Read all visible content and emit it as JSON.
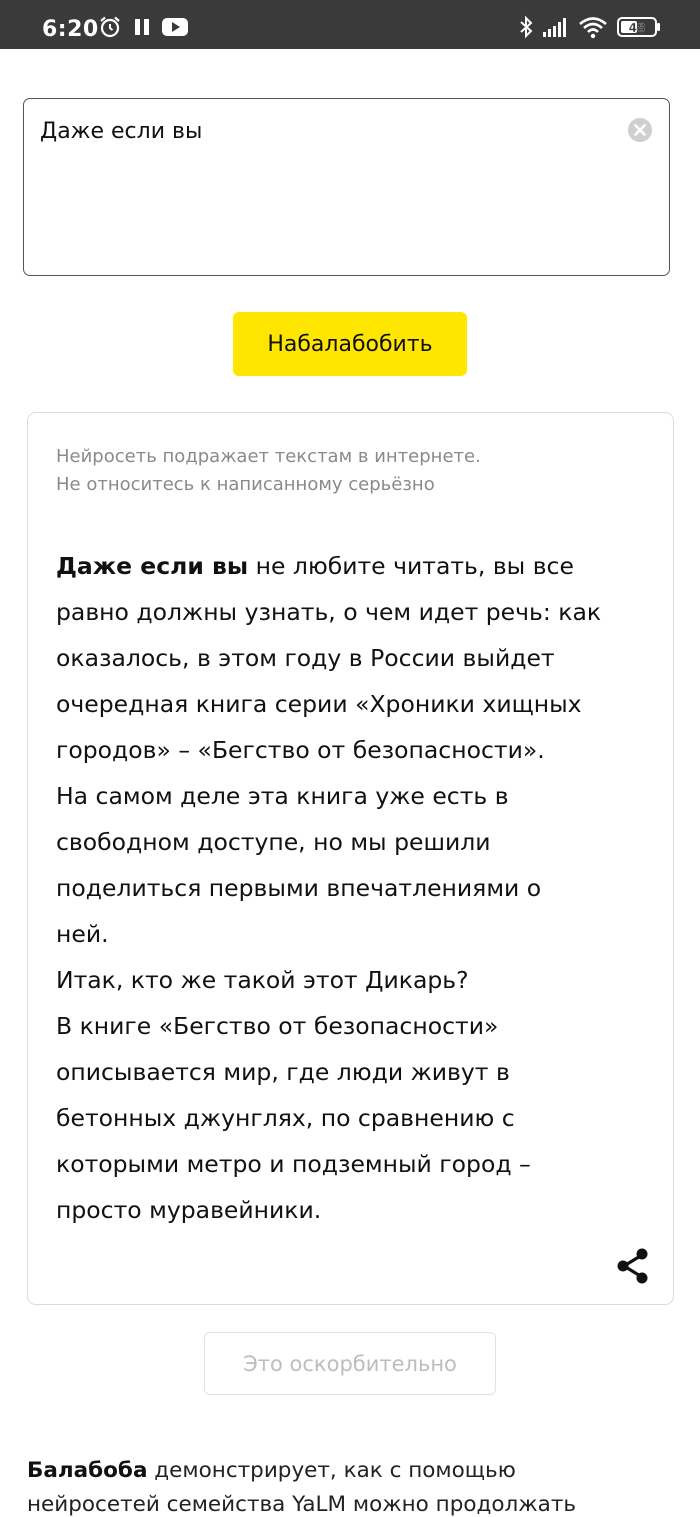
{
  "status_bar": {
    "time": "6:20",
    "battery": "48"
  },
  "input": {
    "value": "Даже если вы"
  },
  "generate_button": {
    "label": "Набалабобить"
  },
  "result": {
    "disclaimer_line1": "Нейросеть подражает текстам в интернете.",
    "disclaimer_line2": "Не относитесь к написанному серьёзно",
    "prompt_bold": "Даже если вы",
    "line1_rest": " не любите читать, вы все",
    "line2": "равно должны узнать, о чем идет речь: как",
    "line3": "оказалось, в этом году в России выйдет",
    "line4": "очередная книга серии «Хроники хищных",
    "line5": "городов» – «Бегство от безопасности».",
    "line6": "На самом деле эта книга уже есть в",
    "line7": "свободном доступе, но мы решили",
    "line8": "поделиться первыми впечатлениями о",
    "line9": "ней.",
    "line10": "Итак, кто же такой этот Дикарь?",
    "line11": "В книге «Бегство от безопасности»",
    "line12": "описывается мир, где люди живут в",
    "line13": "бетонных джунглях, по сравнению с",
    "line14": "которыми метро и подземный город –",
    "line15": "просто муравейники."
  },
  "report_button": {
    "label": "Это оскорбительно"
  },
  "about": {
    "brand": "Балабоба",
    "line1_rest": " демонстрирует, как с помощью",
    "line2": "нейросетей семейства YaLM можно продолжать"
  },
  "icons": {
    "alarm": "alarm-icon",
    "pause": "pause-icon",
    "youtube": "youtube-icon",
    "bluetooth": "bluetooth-icon",
    "signal": "signal-icon",
    "wifi": "wifi-icon",
    "battery": "battery-icon",
    "clear": "clear-icon",
    "share": "share-icon"
  }
}
